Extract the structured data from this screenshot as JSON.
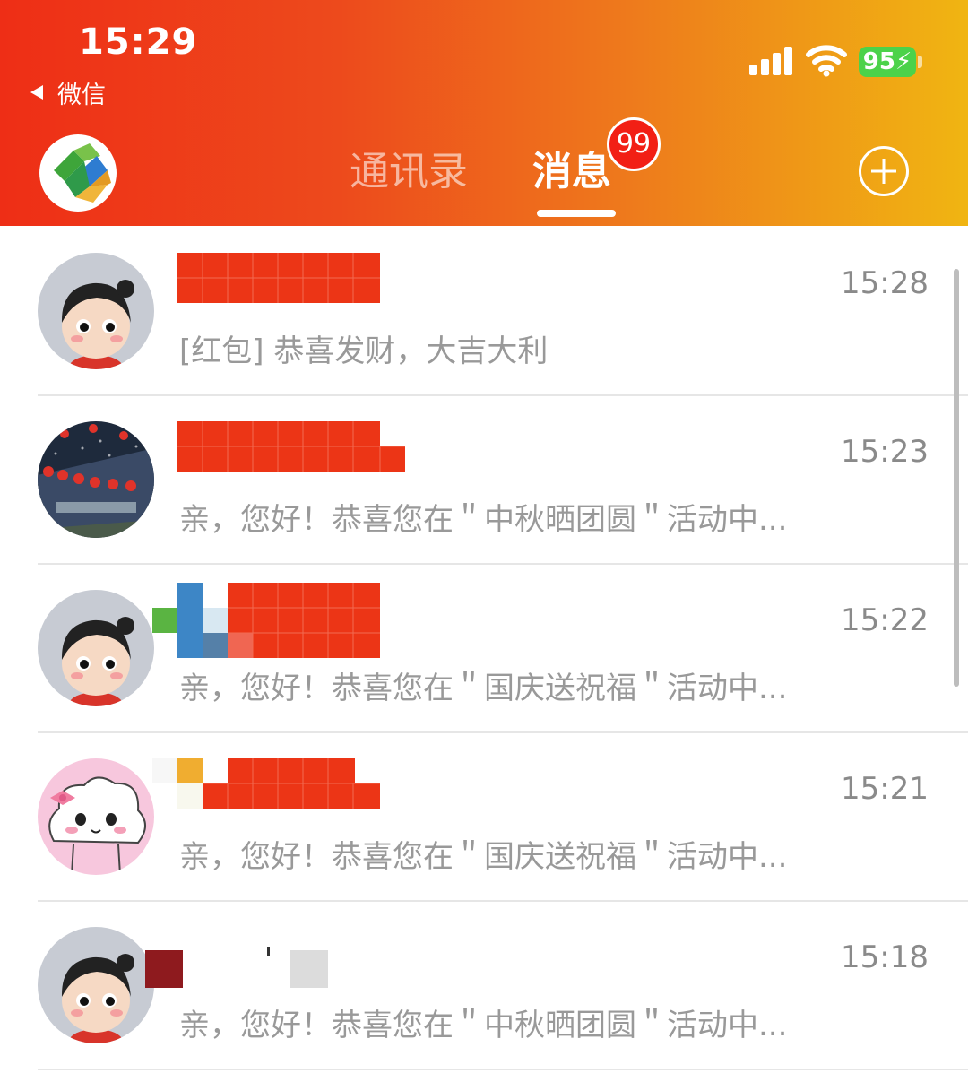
{
  "status_bar": {
    "time": "15:29",
    "battery": "95⚡",
    "back_app_label": "微信"
  },
  "header": {
    "tabs": [
      {
        "label": "通讯录",
        "active": false
      },
      {
        "label": "消息",
        "active": true
      }
    ],
    "unread_badge": "99",
    "icons": {
      "logo": "app-logo-icon",
      "add": "plus-circle-icon"
    }
  },
  "colors": {
    "header_start": "#ee2e16",
    "header_end": "#f0b512",
    "badge": "#f21f15",
    "battery": "#4cd24a"
  },
  "conversations": [
    {
      "avatar": "cartoon-girl",
      "time": "15:28",
      "preview": "[红包] 恭喜发财，大吉大利"
    },
    {
      "avatar": "night-street-lanterns",
      "time": "15:23",
      "preview": "亲，您好！恭喜您在＂中秋晒团圆＂活动中..."
    },
    {
      "avatar": "cartoon-girl",
      "time": "15:22",
      "preview": "亲，您好！恭喜您在＂国庆送祝福＂活动中..."
    },
    {
      "avatar": "cloud-character",
      "time": "15:21",
      "preview": "亲，您好！恭喜您在＂国庆送祝福＂活动中..."
    },
    {
      "avatar": "cartoon-girl",
      "time": "15:18",
      "preview": "亲，您好！恭喜您在＂中秋晒团圆＂活动中..."
    }
  ]
}
